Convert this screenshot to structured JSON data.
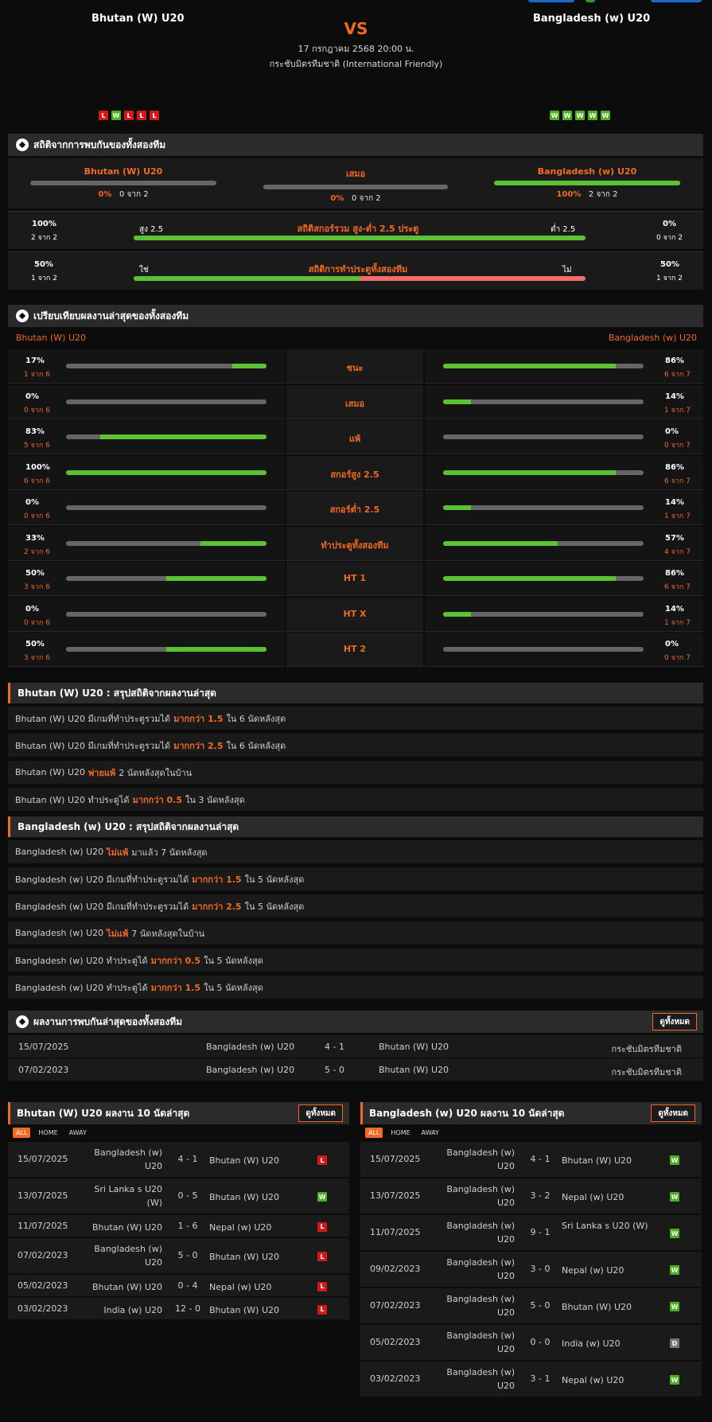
{
  "header": {
    "home_team": "Bhutan (W) U20",
    "away_team": "Bangladesh (w) U20",
    "vs": "VS",
    "datetime": "17 กรกฎาคม 2568 20:00 น.",
    "competition": "กระชับมิตรทีมชาติ (International Friendly)",
    "home_form": [
      "L",
      "W",
      "L",
      "L",
      "L"
    ],
    "away_form": [
      "W",
      "W",
      "W",
      "W",
      "W"
    ]
  },
  "h2h_stats": {
    "title": "สถิติจากการพบกันของทั้งสองทีม",
    "home": {
      "label": "Bhutan (W) U20",
      "pct": "0%",
      "count": "0 จาก 2",
      "value": 0
    },
    "draw": {
      "label": "เสมอ",
      "pct": "0%",
      "count": "0 จาก 2",
      "value": 0
    },
    "away": {
      "label": "Bangladesh (w) U20",
      "pct": "100%",
      "count": "2 จาก 2",
      "value": 100
    },
    "over_under": {
      "title": "สถิติสกอร์รวม สูง-ต่ำ 2.5 ประตู",
      "left_pct": "100%",
      "left_count": "2 จาก 2",
      "left_label": "สูง 2.5",
      "right_pct": "0%",
      "right_count": "0 จาก 2",
      "right_label": "ต่ำ 2.5",
      "value": 100
    },
    "btts": {
      "title": "สถิติการทำประตูทั้งสองทีม",
      "left_pct": "50%",
      "left_count": "1 จาก 2",
      "left_label": "ใช่",
      "right_pct": "50%",
      "right_count": "1 จาก 2",
      "right_label": "ไม่",
      "value": 50
    }
  },
  "compare": {
    "title": "เปรียบเทียบผลงานล่าสุดของทั้งสองทีม",
    "home_team": "Bhutan (W) U20",
    "away_team": "Bangladesh (w) U20",
    "rows": [
      {
        "label": "ชนะ",
        "home_pct": "17%",
        "home_count": "1 จาก 6",
        "home_value": 17,
        "away_pct": "86%",
        "away_count": "6 จาก 7",
        "away_value": 86
      },
      {
        "label": "เสมอ",
        "home_pct": "0%",
        "home_count": "0 จาก 6",
        "home_value": 0,
        "away_pct": "14%",
        "away_count": "1 จาก 7",
        "away_value": 14
      },
      {
        "label": "แพ้",
        "home_pct": "83%",
        "home_count": "5 จาก 6",
        "home_value": 83,
        "away_pct": "0%",
        "away_count": "0 จาก 7",
        "away_value": 0
      },
      {
        "label": "สกอร์สูง 2.5",
        "home_pct": "100%",
        "home_count": "6 จาก 6",
        "home_value": 100,
        "away_pct": "86%",
        "away_count": "6 จาก 7",
        "away_value": 86
      },
      {
        "label": "สกอร์ต่ำ 2.5",
        "home_pct": "0%",
        "home_count": "0 จาก 6",
        "home_value": 0,
        "away_pct": "14%",
        "away_count": "1 จาก 7",
        "away_value": 14
      },
      {
        "label": "ทำประตูทั้งสองทีม",
        "home_pct": "33%",
        "home_count": "2 จาก 6",
        "home_value": 33,
        "away_pct": "57%",
        "away_count": "4 จาก 7",
        "away_value": 57
      },
      {
        "label": "HT 1",
        "home_pct": "50%",
        "home_count": "3 จาก 6",
        "home_value": 50,
        "away_pct": "86%",
        "away_count": "6 จาก 7",
        "away_value": 86
      },
      {
        "label": "HT X",
        "home_pct": "0%",
        "home_count": "0 จาก 6",
        "home_value": 0,
        "away_pct": "14%",
        "away_count": "1 จาก 7",
        "away_value": 14
      },
      {
        "label": "HT 2",
        "home_pct": "50%",
        "home_count": "3 จาก 6",
        "home_value": 50,
        "away_pct": "0%",
        "away_count": "0 จาก 7",
        "away_value": 0
      }
    ]
  },
  "home_summary": {
    "title": "Bhutan (W) U20 : สรุปสถิติจากผลงานล่าสุด",
    "rows": [
      {
        "pre": "Bhutan (W) U20  มีเกมที่ทำประตูรวมได้",
        "hl": "มากกว่า  1.5",
        "post": "ใน 6 นัดหลังสุด"
      },
      {
        "pre": "Bhutan (W) U20  มีเกมที่ทำประตูรวมได้",
        "hl": "มากกว่า  2.5",
        "post": "ใน 6 นัดหลังสุด"
      },
      {
        "pre": "Bhutan (W) U20",
        "hl": "พ่ายแพ้",
        "post": "2  นัดหลังสุดในบ้าน"
      },
      {
        "pre": "Bhutan (W) U20  ทำประตูได้",
        "hl": "มากกว่า  0.5",
        "post": "ใน 3 นัดหลังสุด"
      }
    ]
  },
  "away_summary": {
    "title": "Bangladesh (w) U20 : สรุปสถิติจากผลงานล่าสุด",
    "rows": [
      {
        "pre": "Bangladesh (w) U20",
        "hl": "ไม่แพ้",
        "post": "มาแล้ว 7 นัดหลังสุด"
      },
      {
        "pre": "Bangladesh (w) U20  มีเกมที่ทำประตูรวมได้",
        "hl": "มากกว่า  1.5",
        "post": "ใน 5 นัดหลังสุด"
      },
      {
        "pre": "Bangladesh (w) U20  มีเกมที่ทำประตูรวมได้",
        "hl": "มากกว่า  2.5",
        "post": "ใน 5 นัดหลังสุด"
      },
      {
        "pre": "Bangladesh (w) U20",
        "hl": "ไม่แพ้",
        "post": "7  นัดหลังสุดในบ้าน"
      },
      {
        "pre": "Bangladesh (w) U20  ทำประตูได้",
        "hl": "มากกว่า  0.5",
        "post": "ใน 5 นัดหลังสุด"
      },
      {
        "pre": "Bangladesh (w) U20  ทำประตูได้",
        "hl": "มากกว่า  1.5",
        "post": "ใน 5 นัดหลังสุด"
      }
    ]
  },
  "h2h_results": {
    "title": "ผลงานการพบกันล่าสุดของทั้งสองทีม",
    "view_all": "ดูทั้งหมด",
    "rows": [
      {
        "date": "15/07/2025",
        "home": "Bangladesh (w) U20",
        "score": "4 - 1",
        "away": "Bhutan (W) U20",
        "comp": "กระชับมิตรทีมชาติ"
      },
      {
        "date": "07/02/2023",
        "home": "Bangladesh (w) U20",
        "score": "5 - 0",
        "away": "Bhutan (W) U20",
        "comp": "กระชับมิตรทีมชาติ"
      }
    ]
  },
  "home_last10": {
    "title": "Bhutan (W) U20 ผลงาน 10 นัดล่าสุด",
    "view_all": "ดูทั้งหมด",
    "tabs": [
      "ALL",
      "HOME",
      "AWAY"
    ],
    "rows": [
      {
        "date": "15/07/2025",
        "home": "Bangladesh (w) U20",
        "score": "4 - 1",
        "away": "Bhutan (W) U20",
        "result": "L"
      },
      {
        "date": "13/07/2025",
        "home": "Sri Lanka s U20 (W)",
        "score": "0 - 5",
        "away": "Bhutan (W) U20",
        "result": "W"
      },
      {
        "date": "11/07/2025",
        "home": "Bhutan (W) U20",
        "score": "1 - 6",
        "away": "Nepal (w) U20",
        "result": "L"
      },
      {
        "date": "07/02/2023",
        "home": "Bangladesh (w) U20",
        "score": "5 - 0",
        "away": "Bhutan (W) U20",
        "result": "L"
      },
      {
        "date": "05/02/2023",
        "home": "Bhutan (W) U20",
        "score": "0 - 4",
        "away": "Nepal (w) U20",
        "result": "L"
      },
      {
        "date": "03/02/2023",
        "home": "India (w) U20",
        "score": "12 - 0",
        "away": "Bhutan (W) U20",
        "result": "L"
      }
    ]
  },
  "away_last10": {
    "title": "Bangladesh (w) U20 ผลงาน 10 นัดล่าสุด",
    "view_all": "ดูทั้งหมด",
    "tabs": [
      "ALL",
      "HOME",
      "AWAY"
    ],
    "rows": [
      {
        "date": "15/07/2025",
        "home": "Bangladesh (w) U20",
        "score": "4 - 1",
        "away": "Bhutan (W) U20",
        "result": "W"
      },
      {
        "date": "13/07/2025",
        "home": "Bangladesh (w) U20",
        "score": "3 - 2",
        "away": "Nepal (w) U20",
        "result": "W"
      },
      {
        "date": "11/07/2025",
        "home": "Bangladesh (w) U20",
        "score": "9 - 1",
        "away": "Sri Lanka s U20 (W)",
        "result": "W"
      },
      {
        "date": "09/02/2023",
        "home": "Bangladesh (w) U20",
        "score": "3 - 0",
        "away": "Nepal (w) U20",
        "result": "W"
      },
      {
        "date": "07/02/2023",
        "home": "Bangladesh (w) U20",
        "score": "5 - 0",
        "away": "Bhutan (W) U20",
        "result": "W"
      },
      {
        "date": "05/02/2023",
        "home": "Bangladesh (w) U20",
        "score": "0 - 0",
        "away": "India (w) U20",
        "result": "D"
      },
      {
        "date": "03/02/2023",
        "home": "Bangladesh (w) U20",
        "score": "3 - 1",
        "away": "Nepal (w) U20",
        "result": "W"
      }
    ]
  },
  "colors": {
    "accent": "#f26a21",
    "win": "#4caf1c",
    "loss": "#d21818",
    "draw": "#777777",
    "bar_fill": "#5bc234",
    "bar_red": "#f36b6b"
  }
}
